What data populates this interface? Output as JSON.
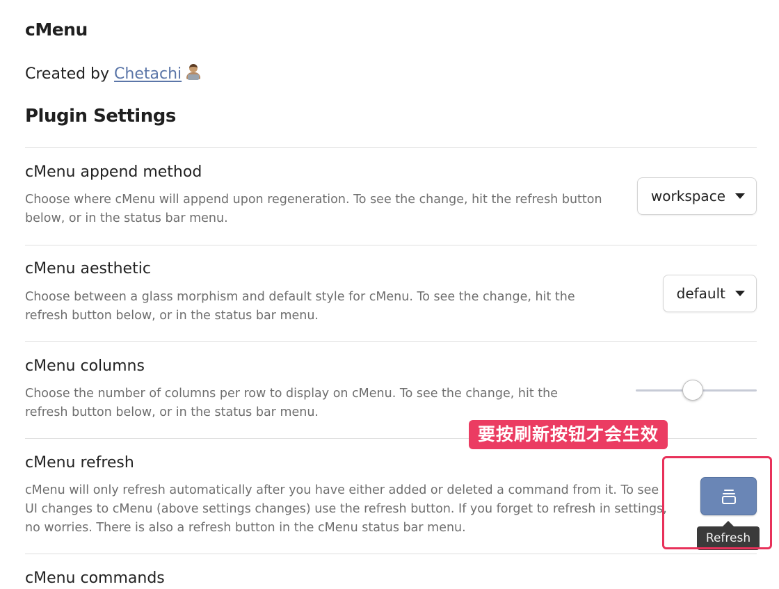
{
  "page": {
    "title": "cMenu",
    "created_by_prefix": "Created by ",
    "author_name": "Chetachi",
    "section_title": "Plugin Settings"
  },
  "settings": [
    {
      "name": "cMenu append method",
      "description": "Choose where cMenu will append upon regeneration. To see the change, hit the refresh button below, or in the status bar menu.",
      "control": "dropdown",
      "value": "workspace"
    },
    {
      "name": "cMenu aesthetic",
      "description": "Choose between a glass morphism and default style for cMenu. To see the change, hit the refresh button below, or in the status bar menu.",
      "control": "dropdown",
      "value": "default"
    },
    {
      "name": "cMenu columns",
      "description": "Choose the number of columns per row to display on cMenu. To see the change, hit the refresh button below, or in the status bar menu.",
      "control": "slider",
      "slider_level": 0.47
    },
    {
      "name": "cMenu refresh",
      "description": "cMenu will only refresh automatically after you have either added or deleted a command from it. To see UI changes to cMenu (above settings changes) use the refresh button. If you forget to refresh in settings, no worries. There is also a refresh button in the cMenu status bar menu.",
      "control": "button",
      "button_icon": "refresh-stack-icon",
      "tooltip": "Refresh"
    },
    {
      "name": "cMenu commands"
    }
  ],
  "annotation": {
    "label": "要按刷新按钮才会生效",
    "color": "#e8315a"
  },
  "colors": {
    "accent_button": "#6a86b6",
    "link": "#5b76a8"
  }
}
